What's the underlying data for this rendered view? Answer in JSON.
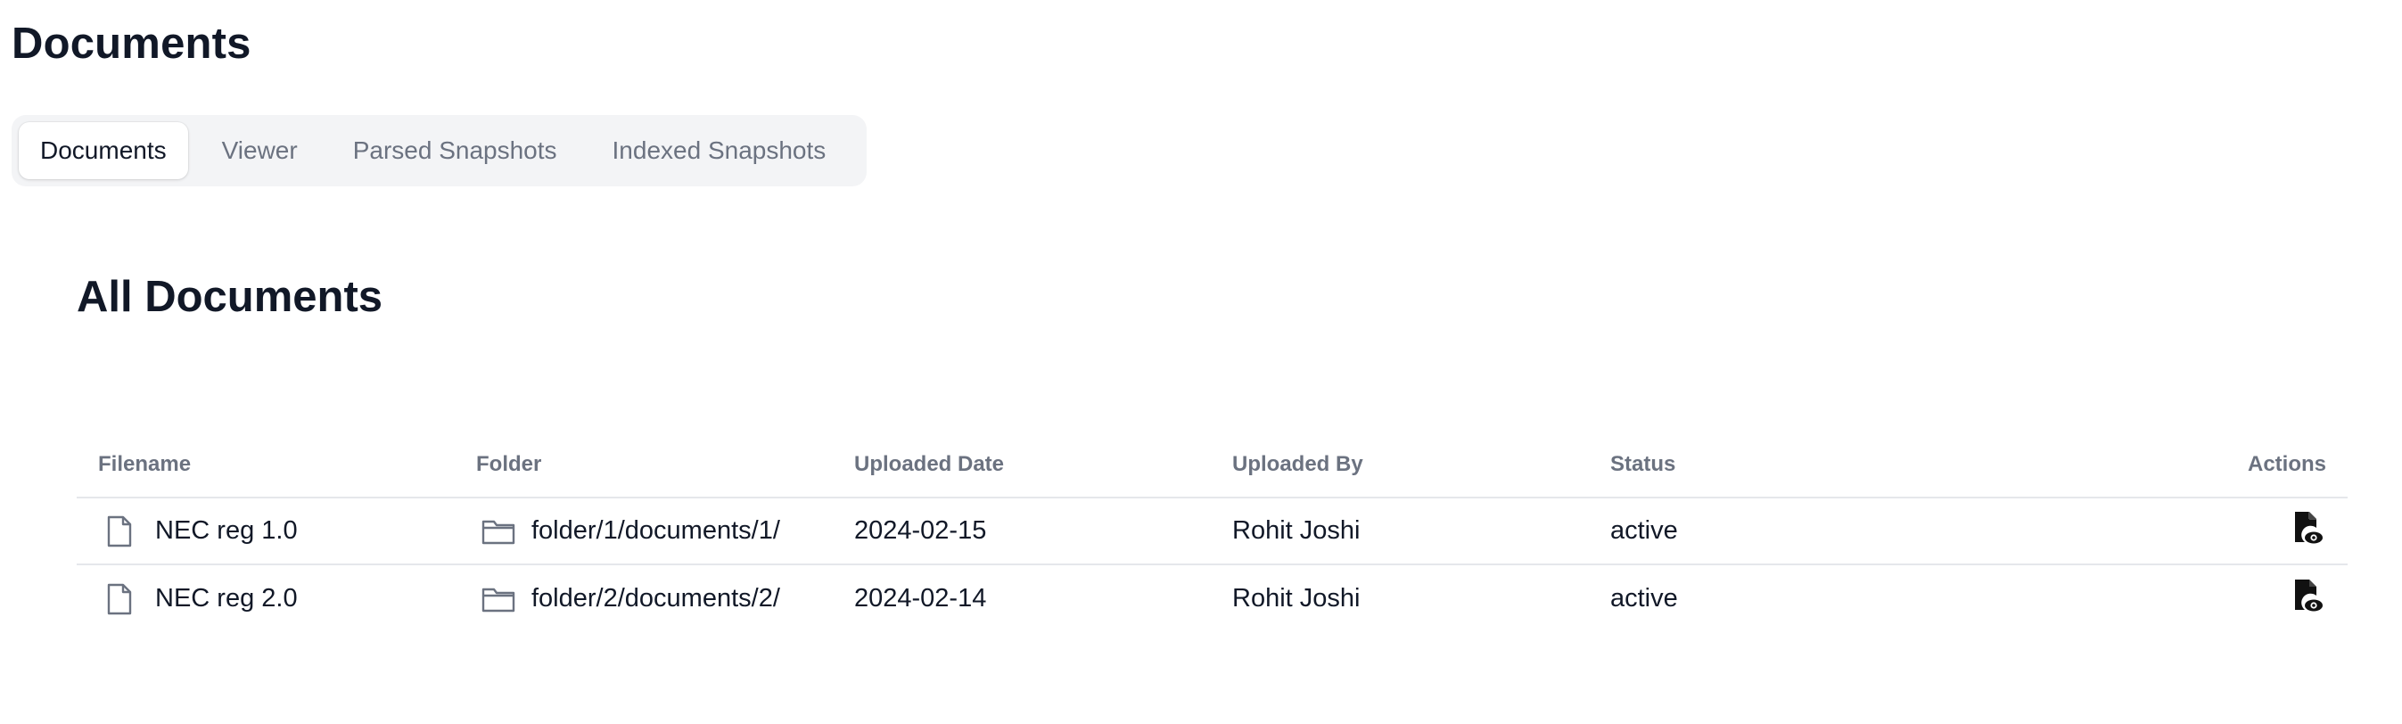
{
  "page": {
    "title": "Documents"
  },
  "tabs": [
    {
      "label": "Documents",
      "active": true
    },
    {
      "label": "Viewer",
      "active": false
    },
    {
      "label": "Parsed Snapshots",
      "active": false
    },
    {
      "label": "Indexed Snapshots",
      "active": false
    }
  ],
  "section": {
    "title": "All Documents"
  },
  "table": {
    "headers": {
      "filename": "Filename",
      "folder": "Folder",
      "uploaded_date": "Uploaded Date",
      "uploaded_by": "Uploaded By",
      "status": "Status",
      "actions": "Actions"
    },
    "rows": [
      {
        "filename": "NEC reg 1.0",
        "folder": "folder/1/documents/1/",
        "uploaded_date": "2024-02-15",
        "uploaded_by": "Rohit Joshi",
        "status": "active",
        "file_icon": "file-icon",
        "folder_icon": "folder-icon",
        "action_icon": "file-view-icon"
      },
      {
        "filename": "NEC reg 2.0",
        "folder": "folder/2/documents/2/",
        "uploaded_date": "2024-02-14",
        "uploaded_by": "Rohit Joshi",
        "status": "active",
        "file_icon": "file-icon",
        "folder_icon": "folder-icon",
        "action_icon": "file-view-icon"
      }
    ]
  },
  "colors": {
    "text_primary": "#111827",
    "text_muted": "#6b7280",
    "tab_bar_bg": "#f3f4f6",
    "divider": "#e5e7eb"
  }
}
